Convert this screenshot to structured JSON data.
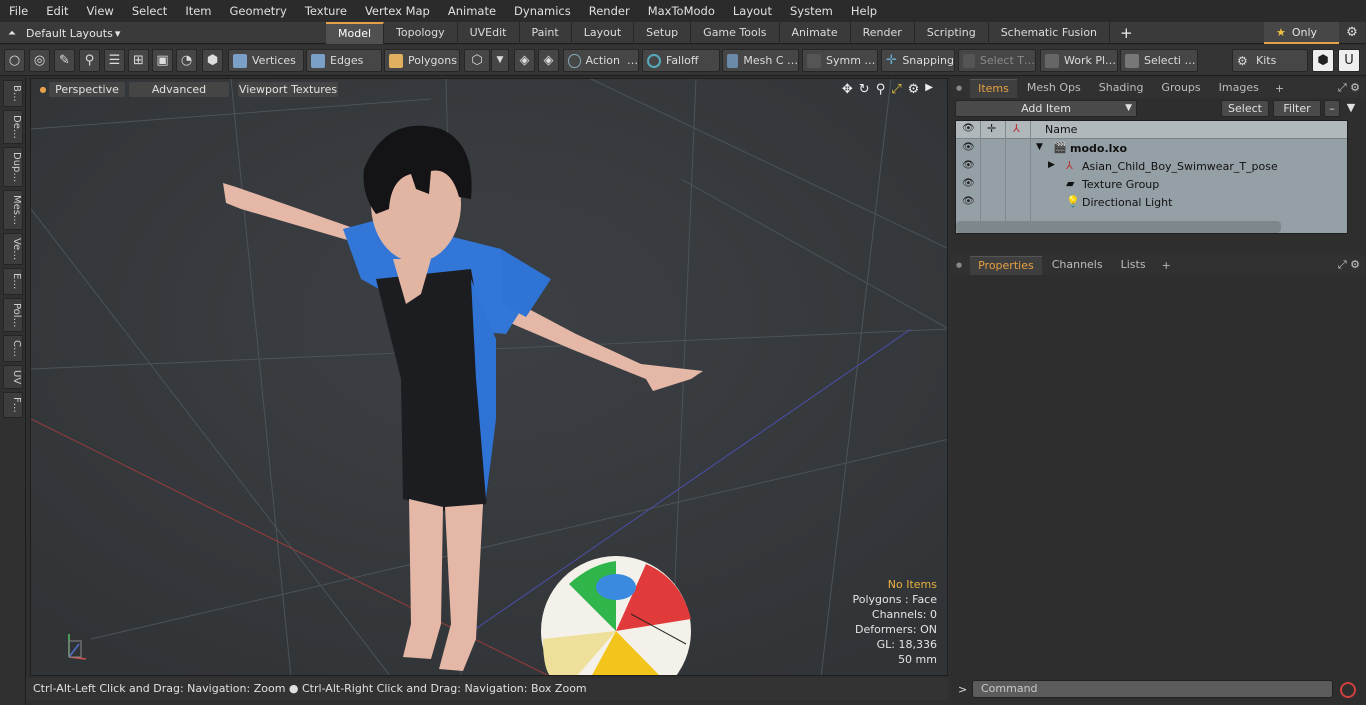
{
  "menu": [
    "File",
    "Edit",
    "View",
    "Select",
    "Item",
    "Geometry",
    "Texture",
    "Vertex Map",
    "Animate",
    "Dynamics",
    "Render",
    "MaxToModo",
    "Layout",
    "System",
    "Help"
  ],
  "layouts": {
    "label": "Default Layouts",
    "arrow": "▾"
  },
  "tabs": [
    "Model",
    "Topology",
    "UVEdit",
    "Paint",
    "Layout",
    "Setup",
    "Game Tools",
    "Animate",
    "Render",
    "Scripting",
    "Schematic Fusion"
  ],
  "only_label": "Only",
  "toolbar": {
    "vertices": "Vertices",
    "edges": "Edges",
    "polygons": "Polygons",
    "action": "Action",
    "action_more": "…",
    "falloff": "Falloff",
    "mesh": "Mesh C …",
    "symm": "Symm …",
    "snapping": "Snapping",
    "select_t": "Select T…",
    "work": "Work Pl…",
    "selecti": "Selecti …",
    "kits": "Kits"
  },
  "left_tabs": [
    "B…",
    "De…",
    "Dup…",
    "Mes…",
    "Ve…",
    "E…",
    "Pol…",
    "C…",
    "UV",
    "F…"
  ],
  "viewport": {
    "perspective": "Perspective",
    "advanced": "Advanced",
    "textures": "Viewport Textures",
    "info": {
      "no_items": "No Items",
      "polygons": "Polygons : Face",
      "channels": "Channels: 0",
      "deformers": "Deformers: ON",
      "gl": "GL: 18,336",
      "size": "50 mm"
    }
  },
  "status": "Ctrl-Alt-Left Click and Drag: Navigation: Zoom ● Ctrl-Alt-Right Click and Drag: Navigation: Box Zoom",
  "items_panel": {
    "tabs": [
      "Items",
      "Mesh Ops",
      "Shading",
      "Groups",
      "Images"
    ],
    "add_item": "Add Item",
    "select": "Select",
    "filter": "Filter",
    "name_header": "Name",
    "rows": [
      "modo.lxo",
      "Asian_Child_Boy_Swimwear_T_pose",
      "Texture Group",
      "Directional Light"
    ]
  },
  "props_panel": {
    "tabs": [
      "Properties",
      "Channels",
      "Lists"
    ]
  },
  "command": {
    "placeholder": "Command"
  }
}
